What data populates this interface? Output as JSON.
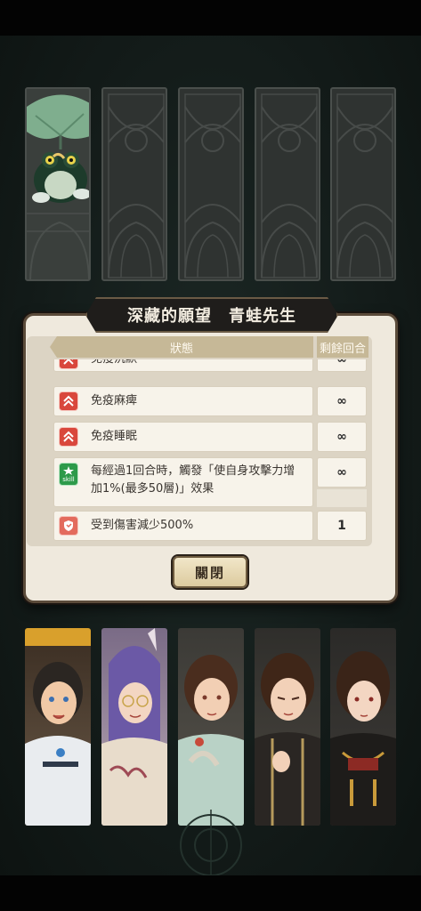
{
  "dialog": {
    "title": "深藏的願望　青蛙先生",
    "header_status": "狀態",
    "header_turns": "剩餘回合",
    "close_label": "關閉"
  },
  "effects": [
    {
      "icon": "immunity-up-icon",
      "label": "免疫沉默",
      "turns": "∞"
    },
    {
      "icon": "immunity-up-icon",
      "label": "免疫麻痺",
      "turns": "∞"
    },
    {
      "icon": "immunity-up-icon",
      "label": "免疫睡眠",
      "turns": "∞"
    },
    {
      "icon": "skill-icon",
      "icon_text": "skill",
      "label_line1": "每經過1回合時，觸發「使自身攻擊力增",
      "label_line2": "加1%(最多50層)」效果",
      "turns": "∞"
    },
    {
      "icon": "damage-reduction-icon",
      "label": "受到傷害減少500%",
      "turns": "1"
    }
  ],
  "team_slots": {
    "top": [
      {
        "name": "frog-character",
        "filled": true
      },
      {
        "name": "empty-slot",
        "filled": false
      },
      {
        "name": "empty-slot",
        "filled": false
      },
      {
        "name": "empty-slot",
        "filled": false
      },
      {
        "name": "empty-slot",
        "filled": false
      }
    ],
    "bottom": [
      {
        "name": "hero-portrait-1"
      },
      {
        "name": "hero-portrait-2"
      },
      {
        "name": "hero-portrait-3"
      },
      {
        "name": "hero-portrait-4"
      },
      {
        "name": "hero-portrait-5"
      }
    ]
  },
  "colors": {
    "accent_red": "#d9473c",
    "skill_green": "#2d9a4a",
    "panel_bg": "#efe9dd",
    "title_plate": "#1f1d1b"
  }
}
